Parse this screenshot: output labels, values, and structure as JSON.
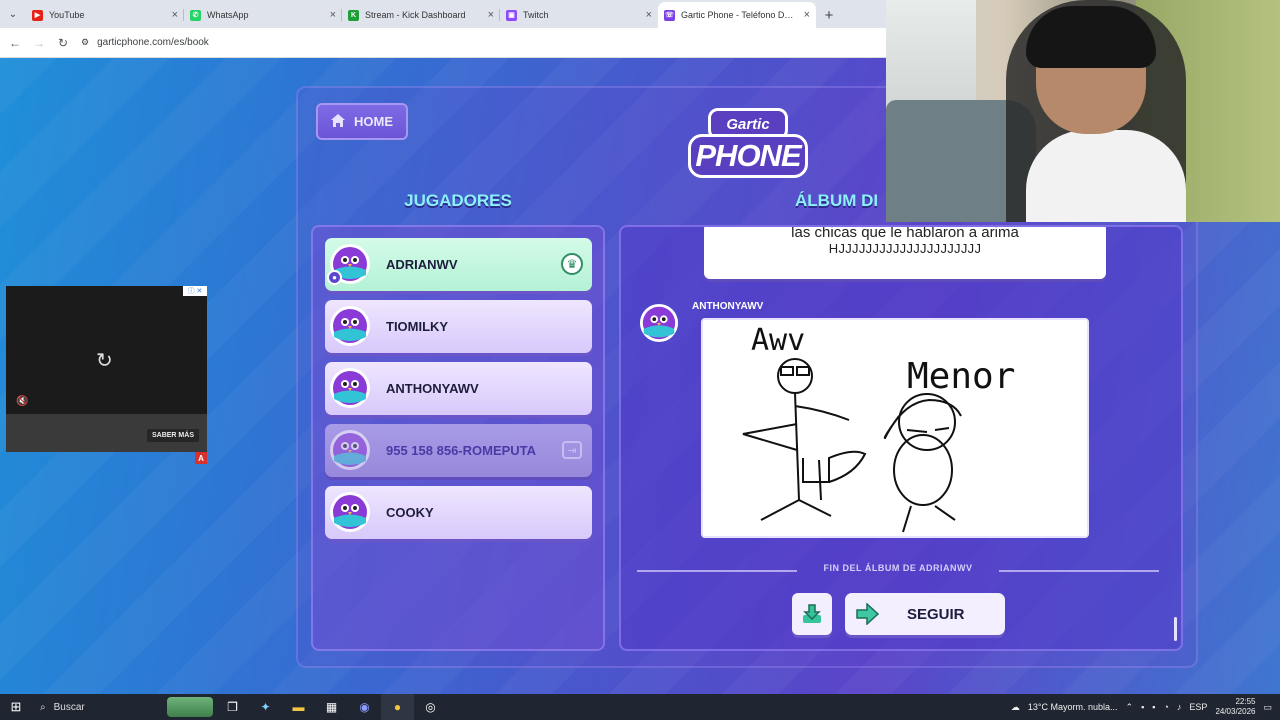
{
  "browser": {
    "tabs": [
      {
        "title": "YouTube",
        "fav_color": "#e62117",
        "fav_glyph": "▶"
      },
      {
        "title": "WhatsApp",
        "fav_color": "#25d366",
        "fav_glyph": "✆"
      },
      {
        "title": "Stream - Kick Dashboard",
        "fav_color": "#1e9e36",
        "fav_glyph": "K"
      },
      {
        "title": "Twitch",
        "fav_color": "#9146ff",
        "fav_glyph": "▣"
      },
      {
        "title": "Gartic Phone - Teléfono Descom",
        "fav_color": "#7b3fe4",
        "fav_glyph": "☏"
      }
    ],
    "url": "garticphone.com/es/book"
  },
  "game": {
    "home_label": "HOME",
    "logo": {
      "top": "Gartic",
      "bottom": "PHONE"
    },
    "players_heading": "JUGADORES",
    "album_heading": "ÁLBUM DI",
    "players": [
      {
        "name": "ADRIANWV",
        "state": "host"
      },
      {
        "name": "TIOMILKY",
        "state": "normal"
      },
      {
        "name": "ANTHONYAWV",
        "state": "normal"
      },
      {
        "name": "955 158 856-ROMEPUTA",
        "state": "disconnected"
      },
      {
        "name": "COOKY",
        "state": "normal"
      }
    ],
    "album": {
      "prev_text_line1": "las chicas que le hablaron a arima",
      "prev_text_line2": "HJJJJJJJJJJJJJJJJJJJJJ",
      "drawing_author": "ANTHONYAWV",
      "drawing_words": {
        "left": "Awv",
        "right": "Menor"
      },
      "end_label": "FIN DEL ÁLBUM DE ADRIANWV",
      "continue_label": "SEGUIR"
    }
  },
  "ad": {
    "learn_more": "SABER MÁS",
    "badge": "A"
  },
  "taskbar": {
    "search_label": "Buscar",
    "weather": "13°C  Mayorm. nubla...",
    "lang": "ESP",
    "time": "22:55",
    "date": "24/03/2026"
  }
}
